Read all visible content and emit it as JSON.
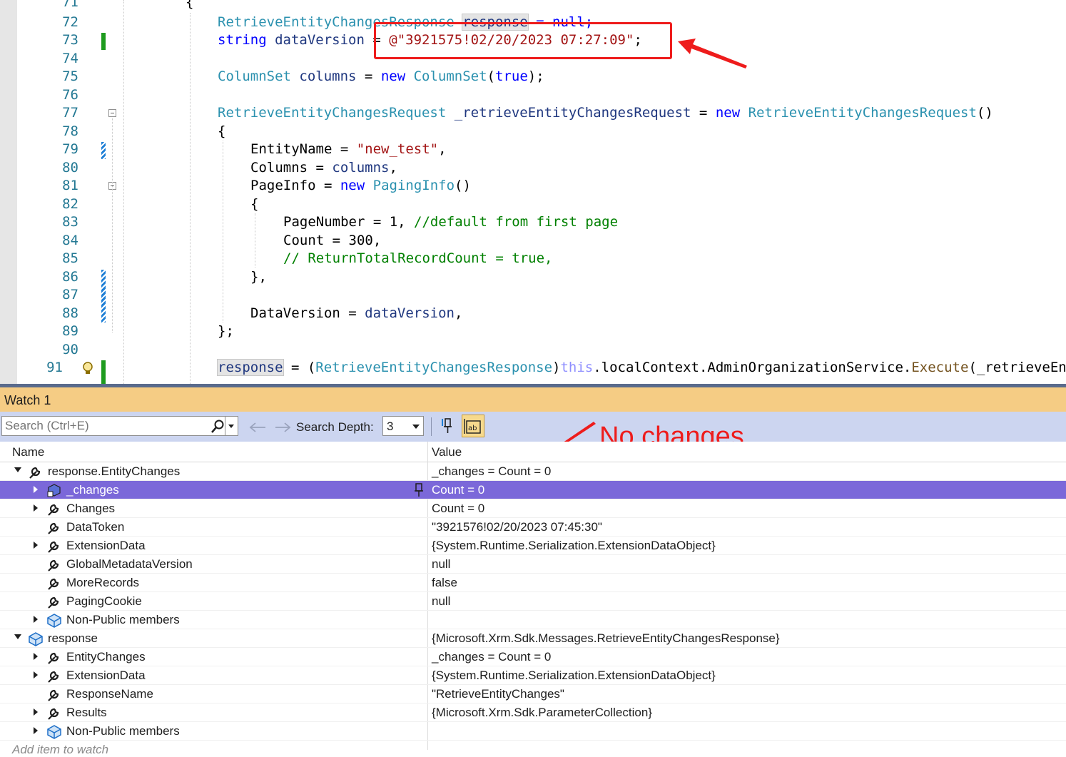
{
  "editor": {
    "lines": [
      {
        "num": "71"
      },
      {
        "num": "72"
      },
      {
        "num": "73"
      },
      {
        "num": "74"
      },
      {
        "num": "75"
      },
      {
        "num": "76"
      },
      {
        "num": "77"
      },
      {
        "num": "78"
      },
      {
        "num": "79"
      },
      {
        "num": "80"
      },
      {
        "num": "81"
      },
      {
        "num": "82"
      },
      {
        "num": "83"
      },
      {
        "num": "84"
      },
      {
        "num": "85"
      },
      {
        "num": "86"
      },
      {
        "num": "87"
      },
      {
        "num": "88"
      },
      {
        "num": "89"
      },
      {
        "num": "90"
      },
      {
        "num": "91"
      }
    ],
    "code": {
      "l71": "{",
      "l72_type": "RetrieveEntityChangesResponse",
      "l72_var": "response",
      "l72_rest": " = null;",
      "l73_kw": "string",
      "l73_var": "dataVersion",
      "l73_eq": " = ",
      "l73_str": "@\"3921575!02/20/2023 07:27:09\"",
      "l73_end": ";",
      "l75_type": "ColumnSet",
      "l75_var": "columns",
      "l75_eq": " = ",
      "l75_new": "new",
      "l75_type2": "ColumnSet",
      "l75_paren1": "(",
      "l75_true": "true",
      "l75_paren2": ");",
      "l77_type": "RetrieveEntityChangesRequest",
      "l77_var": "_retrieveEntityChangesRequest",
      "l77_eq": " = ",
      "l77_new": "new",
      "l77_type2": "RetrieveEntityChangesRequest",
      "l77_end": "()",
      "l78": "{",
      "l79_prop": "EntityName",
      "l79_eq": " = ",
      "l79_str": "\"new_test\"",
      "l79_end": ",",
      "l80_prop": "Columns",
      "l80_eq": " = ",
      "l80_var": "columns",
      "l80_end": ",",
      "l81_prop": "PageInfo",
      "l81_eq": " = ",
      "l81_new": "new",
      "l81_type": "PagingInfo",
      "l81_end": "()",
      "l82": "{",
      "l83_prop": "PageNumber",
      "l83_eq": " = 1, ",
      "l83_cm": "//default from first page",
      "l84_prop": "Count",
      "l84_eq": " = 300,",
      "l85_cm": "// ReturnTotalRecordCount = true,",
      "l86": "},",
      "l88_prop": "DataVersion",
      "l88_eq": " = ",
      "l88_var": "dataVersion",
      "l88_end": ",",
      "l89": "};",
      "l91_var": "response",
      "l91_eq": " = (",
      "l91_type": "RetrieveEntityChangesResponse",
      "l91_paren": ")",
      "l91_this": "this",
      "l91_mid": ".localContext.AdminOrganizationService.",
      "l91_fn": "Execute",
      "l91_tail": "(_retrieveEn"
    }
  },
  "watch": {
    "title": "Watch 1",
    "search_placeholder": "Search (Ctrl+E)",
    "depth_label": "Search Depth:",
    "depth_value": "3",
    "annotation": "No changes",
    "col_name": "Name",
    "col_value": "Value",
    "rows": [
      {
        "name": "response.EntityChanges",
        "value": "_changes = Count = 0"
      },
      {
        "name": "_changes",
        "value": "Count = 0"
      },
      {
        "name": "Changes",
        "value": "Count = 0"
      },
      {
        "name": "DataToken",
        "value": "\"3921576!02/20/2023 07:45:30\""
      },
      {
        "name": "ExtensionData",
        "value": "{System.Runtime.Serialization.ExtensionDataObject}"
      },
      {
        "name": "GlobalMetadataVersion",
        "value": "null"
      },
      {
        "name": "MoreRecords",
        "value": "false"
      },
      {
        "name": "PagingCookie",
        "value": "null"
      },
      {
        "name": "Non-Public members",
        "value": ""
      },
      {
        "name": "response",
        "value": "{Microsoft.Xrm.Sdk.Messages.RetrieveEntityChangesResponse}"
      },
      {
        "name": "EntityChanges",
        "value": "_changes = Count = 0"
      },
      {
        "name": "ExtensionData",
        "value": "{System.Runtime.Serialization.ExtensionDataObject}"
      },
      {
        "name": "ResponseName",
        "value": "\"RetrieveEntityChanges\""
      },
      {
        "name": "Results",
        "value": "{Microsoft.Xrm.Sdk.ParameterCollection}"
      },
      {
        "name": "Non-Public members",
        "value": ""
      }
    ],
    "add_item": "Add item to watch"
  },
  "colors": {
    "annotation": "#ee1c1c",
    "selected_row": "#7b68d9",
    "watch_title_bg": "#f5cc84",
    "toolbar_bg": "#ccd5f0"
  }
}
